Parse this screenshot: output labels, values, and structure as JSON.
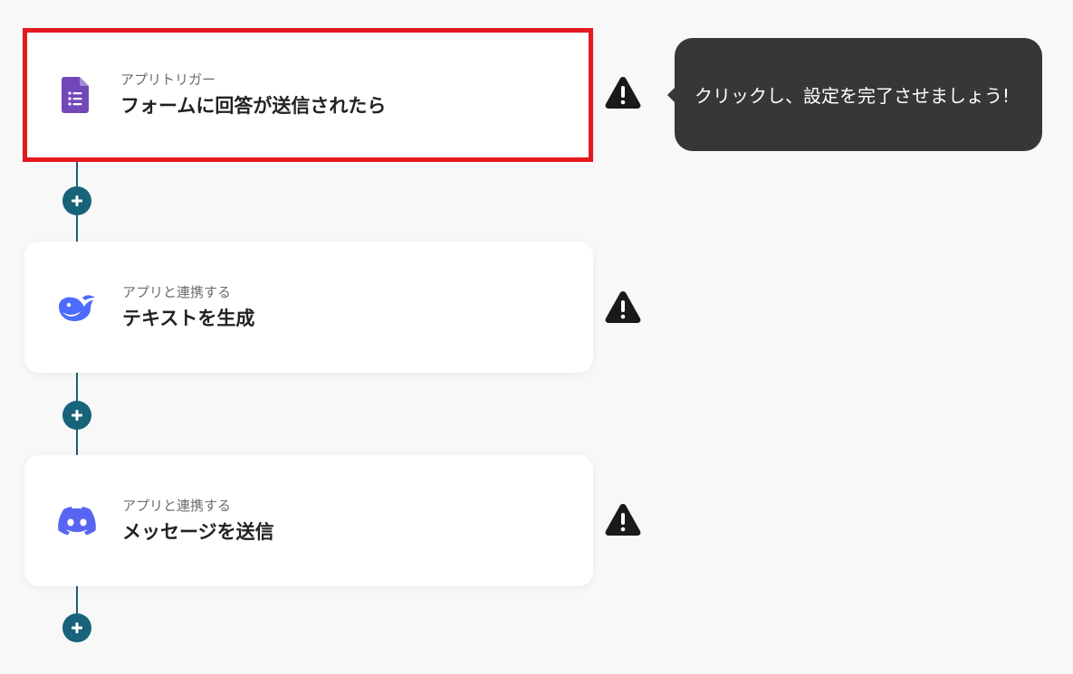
{
  "flow": {
    "steps": [
      {
        "subtitle": "アプリトリガー",
        "title": "フォームに回答が送信されたら",
        "icon": "google-forms-icon",
        "icon_color": "#7248b9",
        "selected": true
      },
      {
        "subtitle": "アプリと連携する",
        "title": "テキストを生成",
        "icon": "deepseek-whale-icon",
        "icon_color": "#4d6bfe",
        "selected": false
      },
      {
        "subtitle": "アプリと連携する",
        "title": "メッセージを送信",
        "icon": "discord-icon",
        "icon_color": "#5865f2",
        "selected": false
      }
    ],
    "add_button_symbol": "+",
    "warning_icon": "warning-triangle-icon"
  },
  "tooltip": {
    "text": "クリックし、設定を完了させましょう!"
  },
  "colors": {
    "background": "#f8f8f8",
    "connector": "#1f5f73",
    "add_button": "#17637a",
    "selected_border": "#e3191f",
    "tooltip_bg": "#373737",
    "warning": "#1a1a1a"
  }
}
